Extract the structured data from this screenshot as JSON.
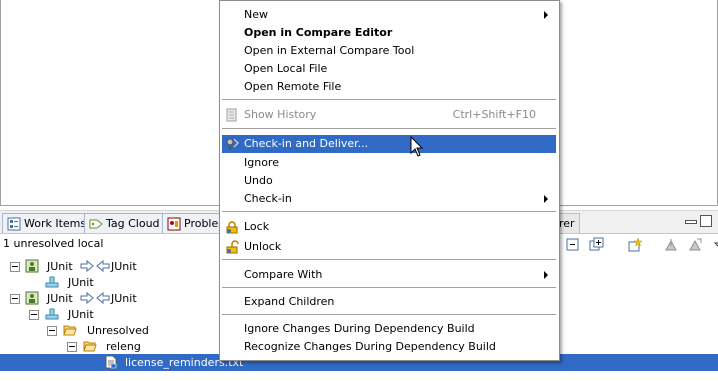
{
  "view_tabs": [
    {
      "label": "Work Items",
      "icon": "work-items-icon"
    },
    {
      "label": "Tag Cloud",
      "icon": "tag-cloud-icon"
    },
    {
      "label": "Problem",
      "icon": "problems-icon"
    },
    {
      "label": "rer",
      "icon": ""
    }
  ],
  "pending": {
    "summary": "1 unresolved local"
  },
  "tree": [
    {
      "label": "JUnit",
      "arrow_left": "JUnit",
      "type": "workspace-flow",
      "level": 0
    },
    {
      "label": "JUnit",
      "type": "component",
      "level": 1
    },
    {
      "label": "JUnit",
      "arrow_left": "JUnit",
      "type": "workspace-flow",
      "level": 0
    },
    {
      "label": "JUnit",
      "type": "component",
      "level": 1
    },
    {
      "label": "Unresolved",
      "type": "folder",
      "level": 2
    },
    {
      "label": "releng",
      "type": "folder",
      "level": 3
    },
    {
      "label": "license_reminders.txt",
      "type": "file",
      "level": 4,
      "selected": true
    }
  ],
  "menu": {
    "items": [
      {
        "label": "New",
        "submenu": true
      },
      {
        "label": "Open in Compare Editor",
        "bold": true
      },
      {
        "label": "Open in External Compare Tool"
      },
      {
        "label": "Open Local File"
      },
      {
        "label": "Open Remote File"
      },
      {
        "separator": true
      },
      {
        "label": "Show History",
        "accel": "Ctrl+Shift+F10",
        "disabled": true,
        "icon": "history-icon"
      },
      {
        "separator": true
      },
      {
        "label": "Check-in and Deliver...",
        "highlighted": true,
        "icon": "check-in-deliver-icon"
      },
      {
        "label": "Ignore"
      },
      {
        "label": "Undo"
      },
      {
        "label": "Check-in",
        "submenu": true
      },
      {
        "separator": true
      },
      {
        "label": "Lock",
        "icon": "lock-icon"
      },
      {
        "label": "Unlock",
        "icon": "unlock-icon"
      },
      {
        "separator": true
      },
      {
        "label": "Compare With",
        "submenu": true
      },
      {
        "separator": true
      },
      {
        "label": "Expand Children"
      },
      {
        "separator": true
      },
      {
        "label": "Ignore Changes During Dependency Build"
      },
      {
        "label": "Recognize Changes During Dependency Build"
      }
    ]
  },
  "colors": {
    "selection": "#316ac5",
    "disabled_text": "#8a8a8a"
  }
}
